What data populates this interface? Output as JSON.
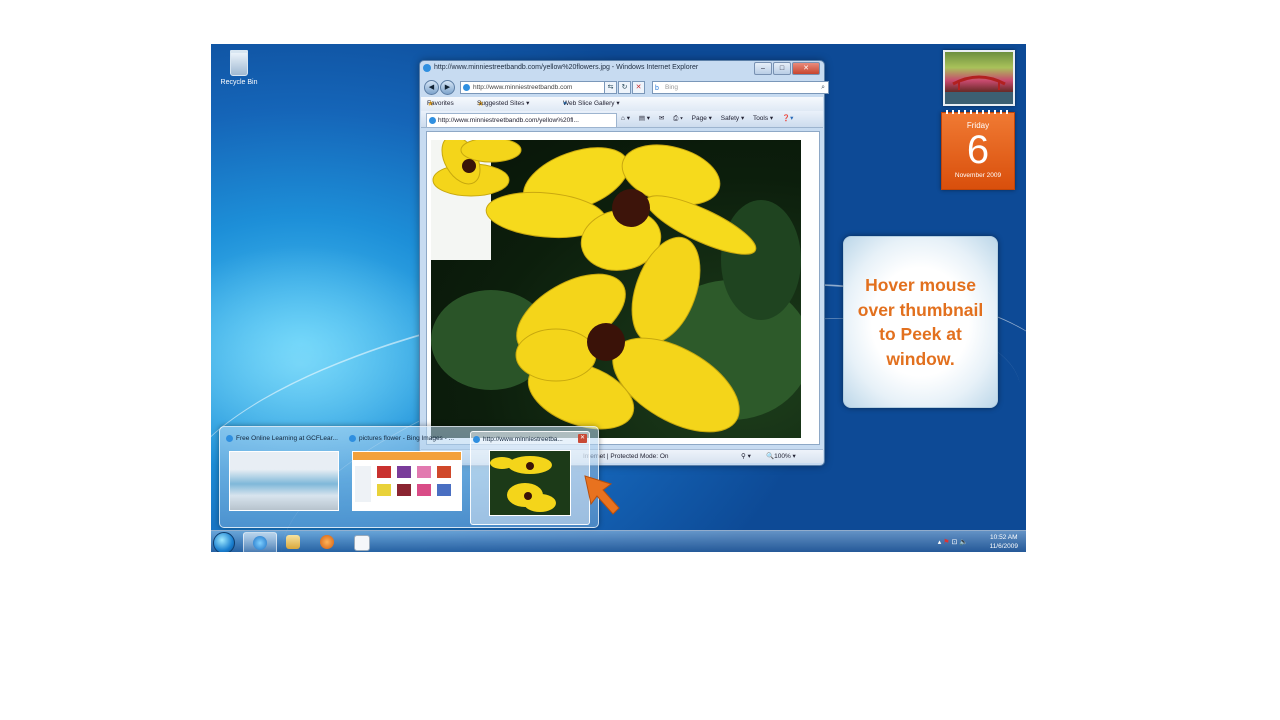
{
  "desktop": {
    "recycle_bin_label": "Recycle Bin"
  },
  "ie_window": {
    "title": "http://www.minniestreetbandb.com/yellow%20flowers.jpg - Windows Internet Explorer",
    "address_url": "http://www.minniestreetbandb.com",
    "search_placeholder": "Bing",
    "favorites_label": "Favorites",
    "suggested_sites_label": "Suggested Sites ▾",
    "web_slice_label": "Web Slice Gallery ▾",
    "tab_title": "http://www.minniestreetbandb.com/yellow%20fl...",
    "command_page": "Page ▾",
    "command_safety": "Safety ▾",
    "command_tools": "Tools ▾",
    "status_text": "Internet | Protected Mode: On",
    "zoom": "100%"
  },
  "gadgets": {
    "calendar_day": "Friday",
    "calendar_date": "6",
    "calendar_month": "November 2009"
  },
  "callout": {
    "text": "Hover mouse over thumbnail to Peek at window."
  },
  "preview": {
    "thumbnails": [
      {
        "title": "Free Online Learning at GCFLear..."
      },
      {
        "title": "pictures flower - Bing Images - ..."
      },
      {
        "title": "http://www.minniestreetba..."
      }
    ]
  },
  "taskbar": {
    "time": "10:52 AM",
    "date": "11/6/2009"
  },
  "colors": {
    "callout_text": "#e2701e",
    "calendar_bg": "#e8631a",
    "arrow": "#e8721f"
  }
}
